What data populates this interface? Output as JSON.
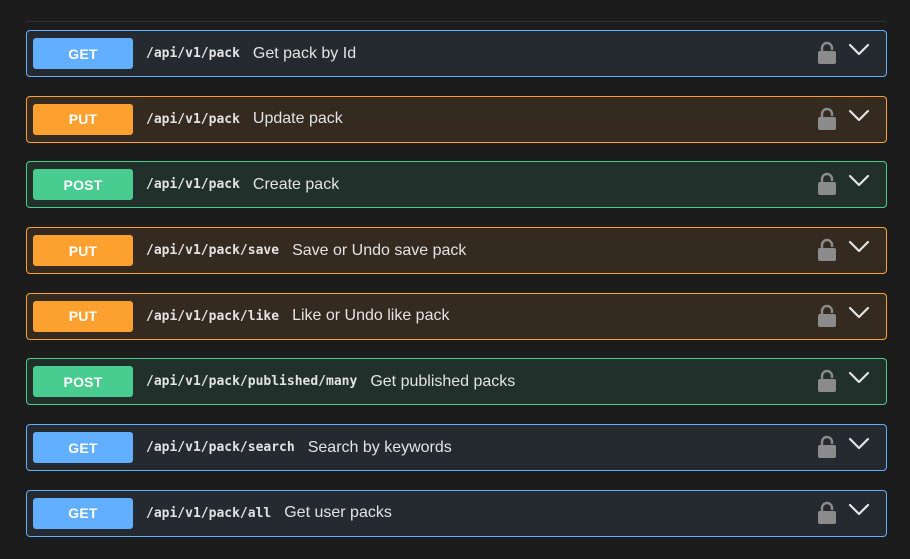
{
  "operations": [
    {
      "method": "GET",
      "path": "/api/v1/pack",
      "summary": "Get pack by Id"
    },
    {
      "method": "PUT",
      "path": "/api/v1/pack",
      "summary": "Update pack"
    },
    {
      "method": "POST",
      "path": "/api/v1/pack",
      "summary": "Create pack"
    },
    {
      "method": "PUT",
      "path": "/api/v1/pack/save",
      "summary": "Save or Undo save pack"
    },
    {
      "method": "PUT",
      "path": "/api/v1/pack/like",
      "summary": "Like or Undo like pack"
    },
    {
      "method": "POST",
      "path": "/api/v1/pack/published/many",
      "summary": "Get published packs"
    },
    {
      "method": "GET",
      "path": "/api/v1/pack/search",
      "summary": "Search by keywords"
    },
    {
      "method": "GET",
      "path": "/api/v1/pack/all",
      "summary": "Get user packs"
    }
  ],
  "icons": {
    "lock": "lock-icon",
    "expand": "chevron-down-icon"
  },
  "colors": {
    "get": "#61affe",
    "put": "#fca130",
    "post": "#49cc90",
    "background": "#1c1c1c",
    "text": "#e3e3e3",
    "icon": "#8b8b8b"
  }
}
